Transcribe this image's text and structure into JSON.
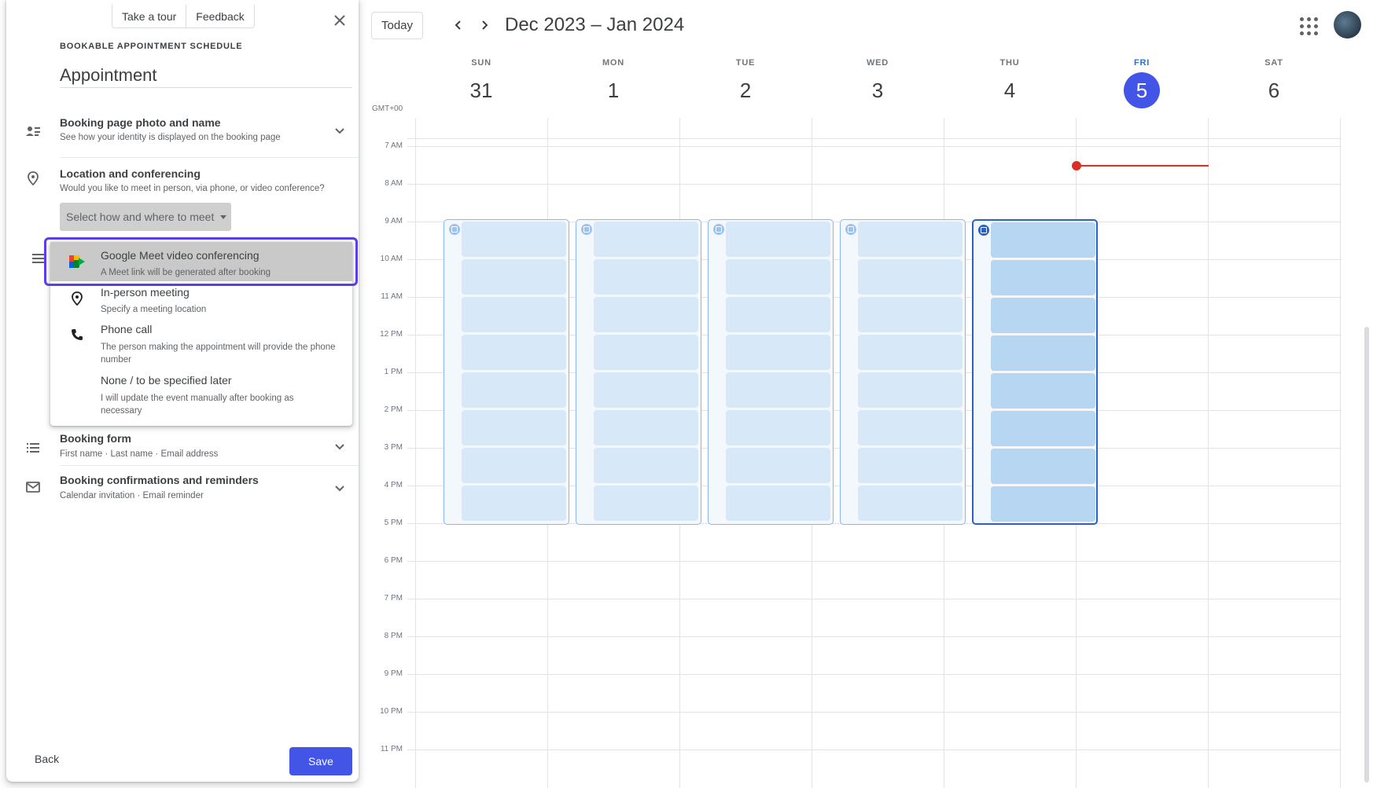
{
  "header": {
    "today_label": "Today",
    "prev_icon": "chevron-left-icon",
    "next_icon": "chevron-right-icon",
    "range_title": "Dec 2023 – Jan 2024",
    "apps_icon": "apps-grid-icon"
  },
  "calendar": {
    "timezone": "GMT+00",
    "days": [
      {
        "dow": "SUN",
        "num": "31"
      },
      {
        "dow": "MON",
        "num": "1"
      },
      {
        "dow": "TUE",
        "num": "2"
      },
      {
        "dow": "WED",
        "num": "3"
      },
      {
        "dow": "THU",
        "num": "4"
      },
      {
        "dow": "FRI",
        "num": "5"
      },
      {
        "dow": "SAT",
        "num": "6"
      }
    ],
    "today_index": 5,
    "hours": [
      "7 AM",
      "8 AM",
      "9 AM",
      "10 AM",
      "11 AM",
      "12 PM",
      "1 PM",
      "2 PM",
      "3 PM",
      "4 PM",
      "5 PM",
      "6 PM",
      "7 PM",
      "8 PM",
      "9 PM",
      "10 PM",
      "11 PM"
    ],
    "accent_color": "#4355e6",
    "now_color": "#d93025"
  },
  "panel": {
    "tour_label": "Take a tour",
    "feedback_label": "Feedback",
    "eyebrow": "BOOKABLE APPOINTMENT SCHEDULE",
    "title_value": "Appointment",
    "sections": {
      "photo": {
        "title": "Booking page photo and name",
        "sub": "See how your identity is displayed on the booking page"
      },
      "location": {
        "title": "Location and conferencing",
        "sub": "Would you like to meet in person, via phone, or video conference?"
      },
      "form": {
        "title": "Booking form",
        "sub": "First name · Last name · Email address"
      },
      "confirm": {
        "title": "Booking confirmations and reminders",
        "sub": "Calendar invitation · Email reminder"
      }
    },
    "select_label": "Select how and where to meet",
    "menu": [
      {
        "title": "Google Meet video conferencing",
        "sub": "A Meet link will be generated after booking"
      },
      {
        "title": "In-person meeting",
        "sub": "Specify a meeting location"
      },
      {
        "title": "Phone call",
        "sub": "The person making the appointment will provide the phone number"
      },
      {
        "title": "None / to be specified later",
        "sub": "I will update the event manually after booking as necessary"
      }
    ],
    "back_label": "Back",
    "save_label": "Save"
  }
}
